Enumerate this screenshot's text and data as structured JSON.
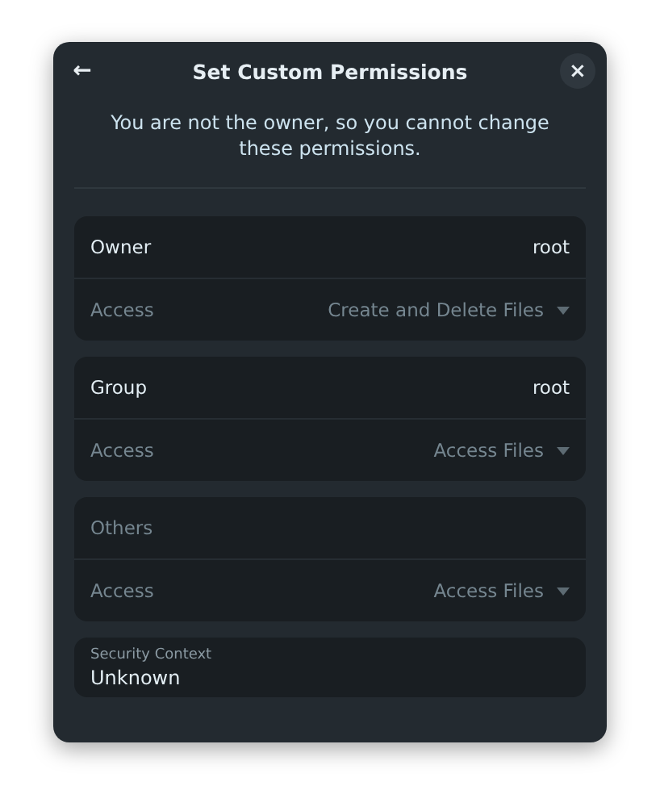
{
  "dialog": {
    "title": "Set Custom Permissions",
    "back_icon": "←",
    "close_icon": "×"
  },
  "message": "You are not the owner, so you cannot change these permissions.",
  "sections": [
    {
      "title": "Owner",
      "value": "root",
      "disabled": false,
      "access": {
        "label": "Access",
        "value": "Create and Delete Files",
        "disabled": true
      }
    },
    {
      "title": "Group",
      "value": "root",
      "disabled": false,
      "access": {
        "label": "Access",
        "value": "Access Files",
        "disabled": true
      }
    },
    {
      "title": "Others",
      "disabled": true,
      "access": {
        "label": "Access",
        "value": "Access Files",
        "disabled": true
      }
    }
  ],
  "security_context": {
    "label": "Security Context",
    "value": "Unknown"
  }
}
